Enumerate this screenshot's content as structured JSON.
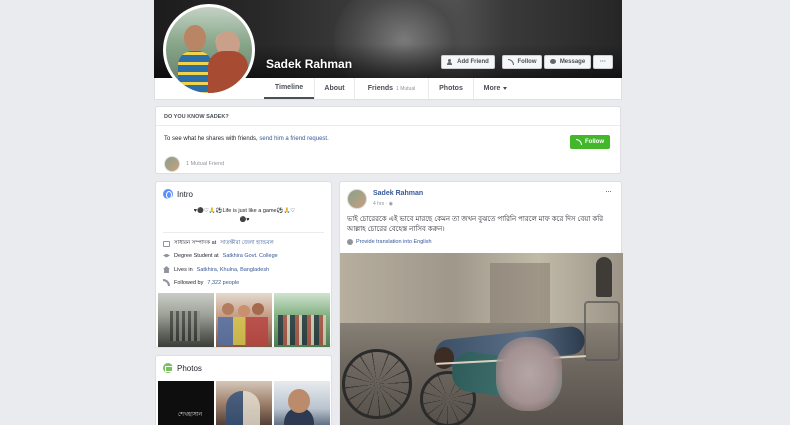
{
  "profile": {
    "name": "Sadek Rahman",
    "buttons": {
      "add_friend": "Add Friend",
      "follow": "Follow",
      "message": "Message",
      "more": "···"
    }
  },
  "tabs": [
    {
      "label": "Timeline"
    },
    {
      "label": "About"
    },
    {
      "label": "Friends",
      "sub": "1 Mutual"
    },
    {
      "label": "Photos"
    },
    {
      "label": "More"
    }
  ],
  "know": {
    "title": "DO YOU KNOW SADEK?",
    "text": "To see what he shares with friends,",
    "link": "send him a friend request.",
    "follow_label": "Follow",
    "mutual": "1 Mutual Friend"
  },
  "intro": {
    "title": "Intro",
    "bio_line1": "♥⚫♡🙏⚽Life is just like a game⚽🙏♡",
    "bio_line2": "⚫♥",
    "rows": [
      {
        "icon": "briefcase-icon",
        "prefix": "সাধারন সম্পাদক at",
        "link": "সাতক্ষীরা জেলা হ্যান্ডবল"
      },
      {
        "icon": "graduation-cap-icon",
        "prefix": "Degree Student at",
        "link": "Satkhira Govt. College"
      },
      {
        "icon": "home-icon",
        "prefix": "Lives in",
        "link": "Satkhira, Khulna, Bangladesh"
      },
      {
        "icon": "rss-icon",
        "prefix": "Followed by",
        "link": "7,322 people"
      }
    ]
  },
  "photos": {
    "title": "Photos",
    "first_caption": "শেখহাসান"
  },
  "post": {
    "author": "Sadek Rahman",
    "time": "4 hrs · ",
    "text": "ভাই চোরেরকে এই ভাবে মারছে কেমন তা জখন বুঝতে পারিনি পারলে মাফ করে দিস বেয়া করি আল্লাহ চোরের বেহেস্ত নাসিব করুন।",
    "translate": "Provide translation into English",
    "more": "···"
  },
  "colors": {
    "link": "#365899",
    "follow_green": "#42b72a",
    "page_bg": "#e9ebee"
  }
}
